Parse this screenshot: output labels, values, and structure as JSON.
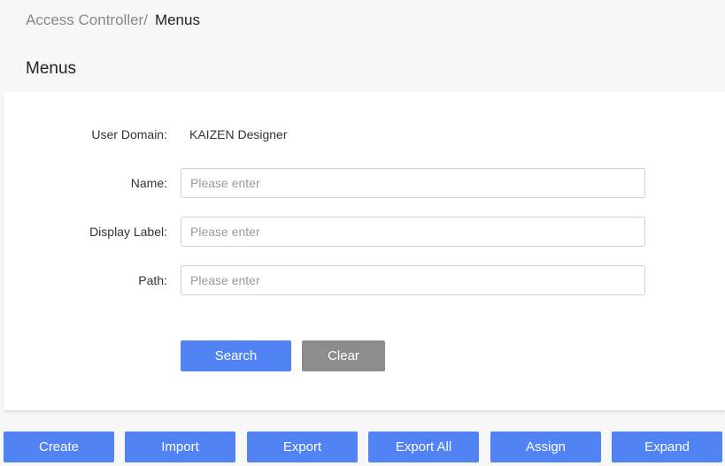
{
  "breadcrumb": {
    "parent": "Access Controller/",
    "current": "Menus"
  },
  "page_title": "Menus",
  "form": {
    "user_domain": {
      "label": "User Domain:",
      "value": "KAIZEN Designer"
    },
    "name": {
      "label": "Name:",
      "placeholder": "Please enter",
      "value": ""
    },
    "display_label": {
      "label": "Display Label:",
      "placeholder": "Please enter",
      "value": ""
    },
    "path": {
      "label": "Path:",
      "placeholder": "Please enter",
      "value": ""
    },
    "search_label": "Search",
    "clear_label": "Clear"
  },
  "actions": {
    "create": "Create",
    "import": "Import",
    "export": "Export",
    "export_all": "Export All",
    "assign": "Assign",
    "expand": "Expand"
  },
  "colors": {
    "primary": "#5283f5",
    "secondary": "#8c8c8c",
    "background": "#f7f7f7",
    "panel": "#ffffff"
  }
}
